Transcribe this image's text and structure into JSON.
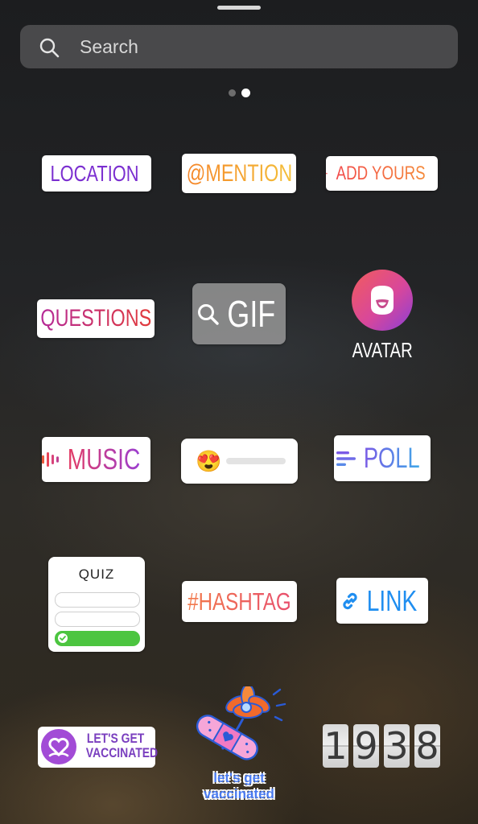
{
  "search": {
    "placeholder": "Search",
    "icon": "search-icon"
  },
  "pager": {
    "pages": 2,
    "active": 2
  },
  "stickers": {
    "location": {
      "label": "LOCATION",
      "icon": "location-pin-icon",
      "color": "#7b2fd0"
    },
    "mention": {
      "label": "@MENTION"
    },
    "add_yours": {
      "label": "ADD YOURS",
      "icon": "camera-icon"
    },
    "questions": {
      "label": "QUESTIONS"
    },
    "gif": {
      "label": "GIF",
      "icon": "search-icon"
    },
    "avatar": {
      "label": "AVATAR",
      "icon": "avatar-icon"
    },
    "music": {
      "label": "MUSIC",
      "icon": "music-bars-icon"
    },
    "emoji_slider": {
      "emoji": "😍",
      "icon": "heart-eyes-emoji-icon"
    },
    "poll": {
      "label": "POLL",
      "icon": "poll-lines-icon"
    },
    "quiz": {
      "label": "QUIZ"
    },
    "hashtag": {
      "label": "#HASHTAG"
    },
    "link": {
      "label": "LINK",
      "icon": "link-icon",
      "color": "#1f8ef0"
    },
    "vaccinated": {
      "line1": "LET'S GET",
      "line2": "VACCINATED",
      "icon": "heart-hands-icon"
    },
    "vaccinated_art": {
      "line1": "let's get",
      "line2": "vaccinated",
      "icon": "bandage-flower-icon"
    },
    "clock": {
      "digits": [
        "1",
        "9",
        "3",
        "8"
      ]
    }
  }
}
